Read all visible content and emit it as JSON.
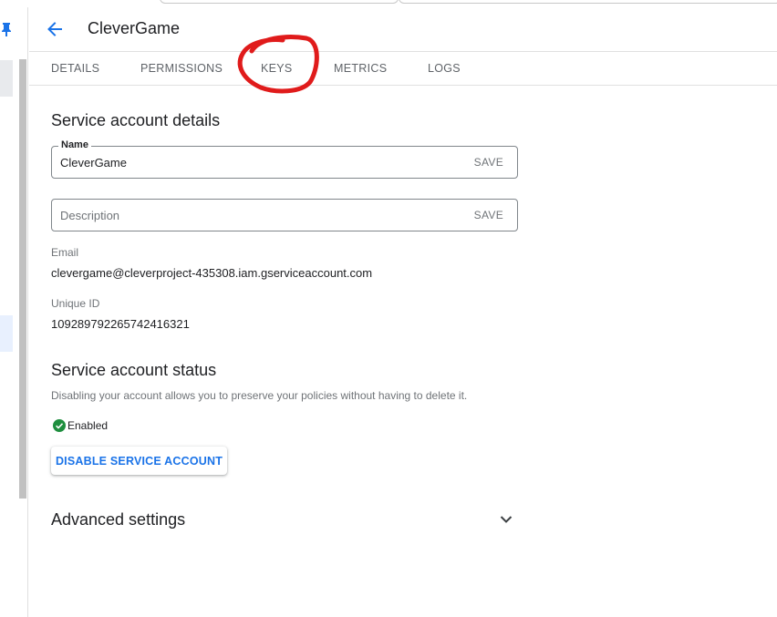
{
  "header": {
    "title": "CleverGame"
  },
  "tabs": [
    {
      "label": "DETAILS"
    },
    {
      "label": "PERMISSIONS"
    },
    {
      "label": "KEYS"
    },
    {
      "label": "METRICS"
    },
    {
      "label": "LOGS"
    }
  ],
  "details": {
    "title": "Service account details",
    "name_field": {
      "legend": "Name",
      "value": "CleverGame",
      "save_label": "SAVE"
    },
    "description_field": {
      "placeholder": "Description",
      "save_label": "SAVE"
    },
    "email_label": "Email",
    "email_value": "clevergame@cleverproject-435308.iam.gserviceaccount.com",
    "unique_id_label": "Unique ID",
    "unique_id_value": "109289792265742416321"
  },
  "status": {
    "title": "Service account status",
    "description": "Disabling your account allows you to preserve your policies without having to delete it.",
    "state": "Enabled",
    "disable_button": "DISABLE SERVICE ACCOUNT"
  },
  "advanced": {
    "title": "Advanced settings"
  },
  "icons": {
    "back": "arrow-back-icon",
    "pin": "pin-icon",
    "check": "check-circle-icon",
    "chevron": "chevron-down-icon"
  },
  "colors": {
    "accent": "#1a73e8",
    "enabled_green": "#1e8e3e",
    "annotation_red": "#e01b1b"
  }
}
